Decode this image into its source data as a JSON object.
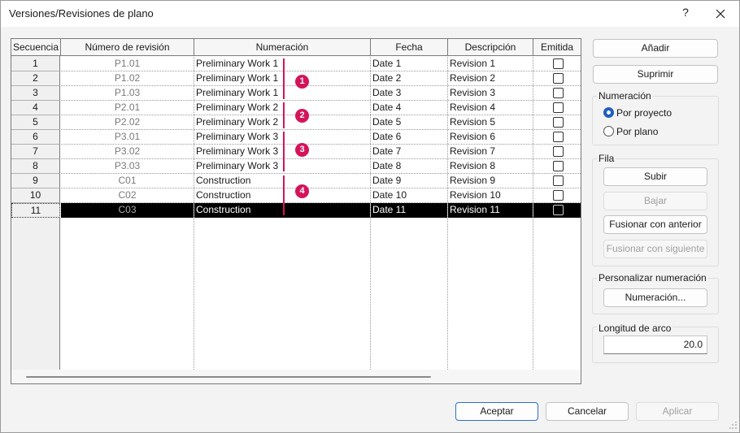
{
  "window": {
    "title": "Versiones/Revisiones de plano",
    "help": "?"
  },
  "grid": {
    "columns": [
      "Secuencia",
      "Número de revisión",
      "Numeración",
      "Fecha",
      "Descripción",
      "Emitida"
    ],
    "rows": [
      {
        "seq": "1",
        "num": "P1.01",
        "numeracion": "Preliminary Work 1",
        "fecha": "Date 1",
        "descripcion": "Revision 1"
      },
      {
        "seq": "2",
        "num": "P1.02",
        "numeracion": "Preliminary Work 1",
        "fecha": "Date 2",
        "descripcion": "Revision 2"
      },
      {
        "seq": "3",
        "num": "P1.03",
        "numeracion": "Preliminary Work 1",
        "fecha": "Date 3",
        "descripcion": "Revision 3"
      },
      {
        "seq": "4",
        "num": "P2.01",
        "numeracion": "Preliminary Work 2",
        "fecha": "Date 4",
        "descripcion": "Revision 4"
      },
      {
        "seq": "5",
        "num": "P2.02",
        "numeracion": "Preliminary Work 2",
        "fecha": "Date 5",
        "descripcion": "Revision 5"
      },
      {
        "seq": "6",
        "num": "P3.01",
        "numeracion": "Preliminary Work 3",
        "fecha": "Date 6",
        "descripcion": "Revision 6"
      },
      {
        "seq": "7",
        "num": "P3.02",
        "numeracion": "Preliminary Work 3",
        "fecha": "Date 7",
        "descripcion": "Revision 7"
      },
      {
        "seq": "8",
        "num": "P3.03",
        "numeracion": "Preliminary Work 3",
        "fecha": "Date 8",
        "descripcion": "Revision 8"
      },
      {
        "seq": "9",
        "num": "C01",
        "numeracion": "Construction",
        "fecha": "Date 9",
        "descripcion": "Revision 9"
      },
      {
        "seq": "10",
        "num": "C02",
        "numeracion": "Construction",
        "fecha": "Date 10",
        "descripcion": "Revision 10"
      },
      {
        "seq": "11",
        "num": "C03",
        "numeracion": "Construction",
        "fecha": "Date 11",
        "descripcion": "Revision 11"
      }
    ],
    "selected_row": "11",
    "callouts": [
      "1",
      "2",
      "3",
      "4"
    ],
    "callout_color": "#d4145a"
  },
  "actions": {
    "add": "Añadir",
    "delete": "Suprimir"
  },
  "numbering": {
    "label": "Numeración",
    "by_project": "Por proyecto",
    "by_sheet": "Por plano",
    "selected": "Por proyecto"
  },
  "row_group": {
    "label": "Fila",
    "up": "Subir",
    "down": "Bajar",
    "merge_prev": "Fusionar con anterior",
    "merge_next": "Fusionar con siguiente"
  },
  "custom_numbering": {
    "label": "Personalizar numeración",
    "button": "Numeración..."
  },
  "arc_length": {
    "label": "Longitud de arco",
    "value": "20.0"
  },
  "footer": {
    "ok": "Aceptar",
    "cancel": "Cancelar",
    "apply": "Aplicar"
  },
  "colors": {
    "accent": "#1f5fbf",
    "selection": "#000000"
  }
}
